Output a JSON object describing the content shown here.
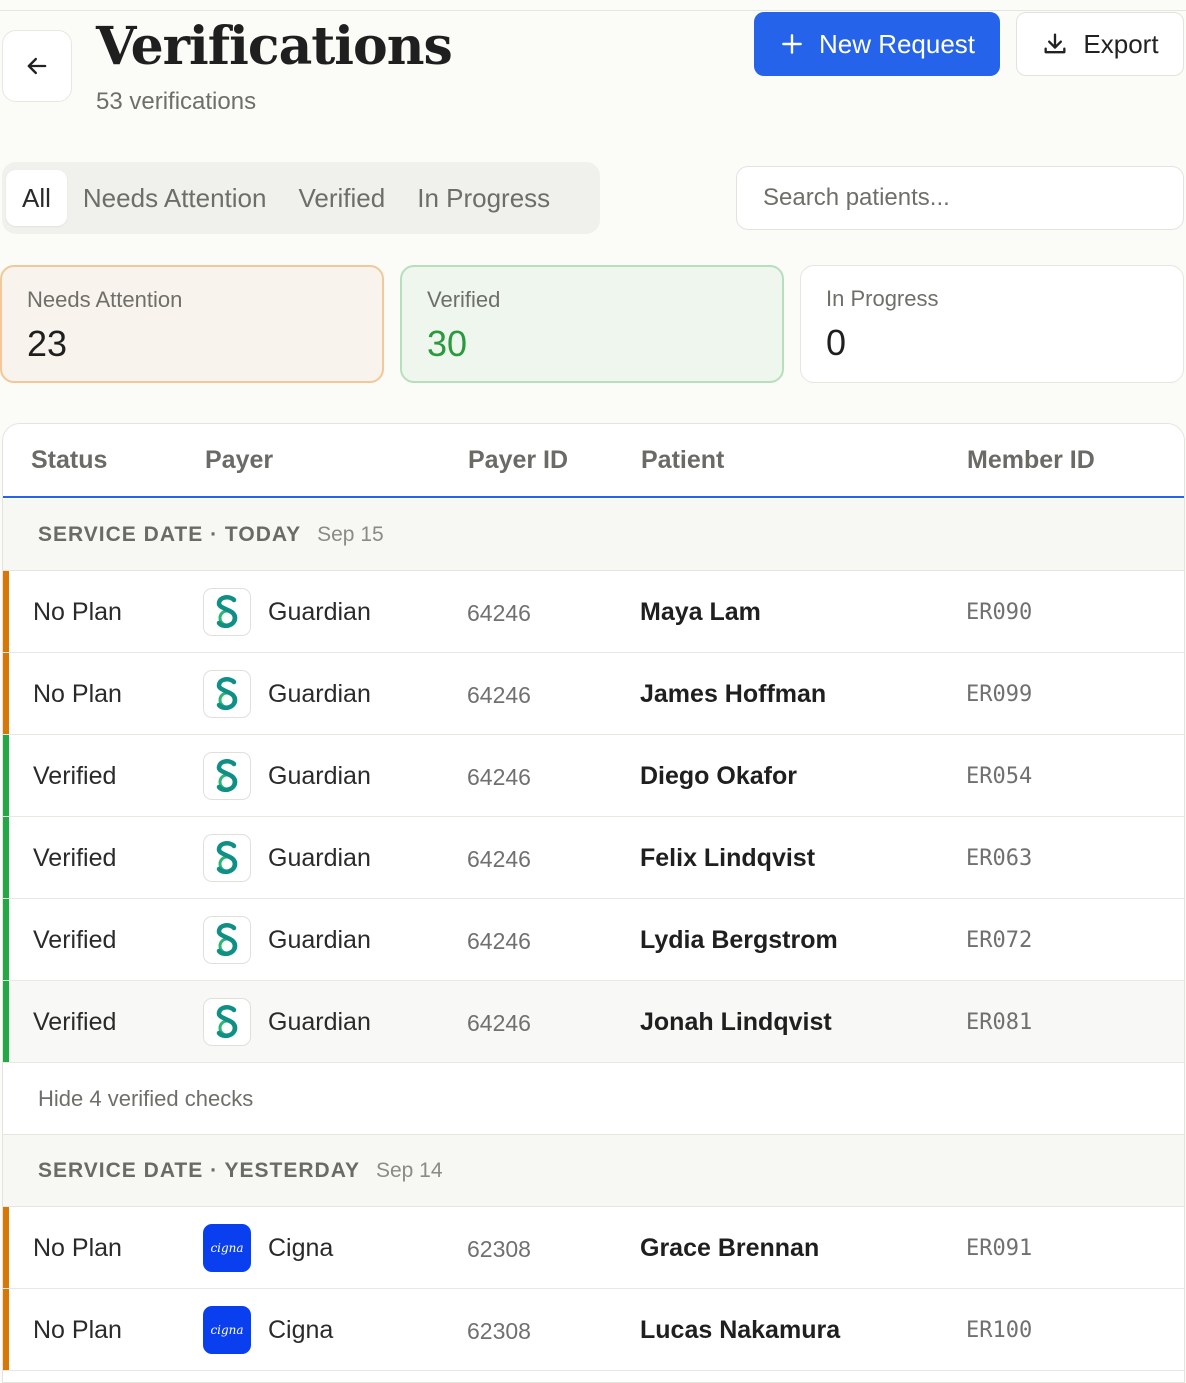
{
  "header": {
    "title": "Verifications",
    "subtitle": "53 verifications",
    "new_request_label": "New Request",
    "export_label": "Export"
  },
  "tabs": [
    {
      "label": "All",
      "active": true
    },
    {
      "label": "Needs Attention",
      "active": false
    },
    {
      "label": "Verified",
      "active": false
    },
    {
      "label": "In Progress",
      "active": false
    }
  ],
  "search": {
    "placeholder": "Search patients..."
  },
  "summary": {
    "needs_attention": {
      "label": "Needs Attention",
      "value": "23"
    },
    "verified": {
      "label": "Verified",
      "value": "30"
    },
    "in_progress": {
      "label": "In Progress",
      "value": "0"
    }
  },
  "table": {
    "columns": [
      "Status",
      "Payer",
      "Payer ID",
      "Patient",
      "Member ID"
    ],
    "groups": [
      {
        "label": "SERVICE DATE · TODAY",
        "date": "Sep 15",
        "rows": [
          {
            "status": "No Plan",
            "payer": "Guardian",
            "payer_id": "64246",
            "patient": "Maya Lam",
            "member_id": "ER090"
          },
          {
            "status": "No Plan",
            "payer": "Guardian",
            "payer_id": "64246",
            "patient": "James Hoffman",
            "member_id": "ER099"
          },
          {
            "status": "Verified",
            "payer": "Guardian",
            "payer_id": "64246",
            "patient": "Diego Okafor",
            "member_id": "ER054"
          },
          {
            "status": "Verified",
            "payer": "Guardian",
            "payer_id": "64246",
            "patient": "Felix Lindqvist",
            "member_id": "ER063"
          },
          {
            "status": "Verified",
            "payer": "Guardian",
            "payer_id": "64246",
            "patient": "Lydia Bergstrom",
            "member_id": "ER072"
          },
          {
            "status": "Verified",
            "payer": "Guardian",
            "payer_id": "64246",
            "patient": "Jonah Lindqvist",
            "member_id": "ER081"
          }
        ],
        "toggle_label": "Hide 4 verified checks"
      },
      {
        "label": "SERVICE DATE · YESTERDAY",
        "date": "Sep 14",
        "rows": [
          {
            "status": "No Plan",
            "payer": "Cigna",
            "payer_id": "62308",
            "patient": "Grace Brennan",
            "member_id": "ER091"
          },
          {
            "status": "No Plan",
            "payer": "Cigna",
            "payer_id": "62308",
            "patient": "Lucas Nakamura",
            "member_id": "ER100"
          }
        ]
      }
    ]
  },
  "logos": {
    "cigna_text": "cigna"
  },
  "colors": {
    "accent": "#2563eb",
    "needs_attention": "#d97706",
    "verified": "#22a845",
    "guardian_teal": "#0f8f86",
    "cigna_blue": "#0a3ff0"
  },
  "icons": {
    "back": "arrow-left-icon",
    "new_request": "plus-icon",
    "export": "download-icon",
    "guardian_logo": "guardian-logo",
    "cigna_logo": "cigna-logo"
  }
}
